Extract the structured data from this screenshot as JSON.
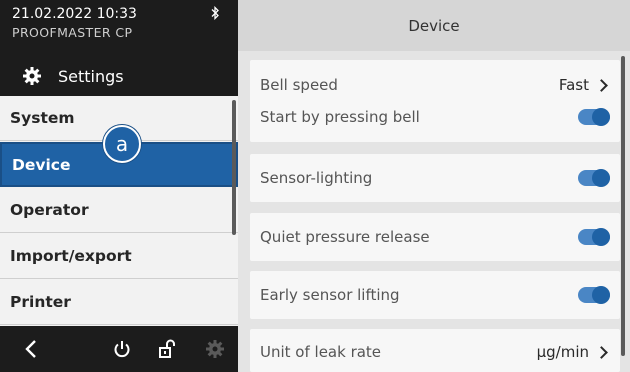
{
  "status": {
    "datetime": "21.02.2022 10:33",
    "device_name": "PROOFMASTER CP",
    "bluetooth_icon": "bluetooth-icon"
  },
  "sidebar": {
    "header_label": "Settings",
    "header_icon": "gear-icon",
    "items": [
      {
        "label": "System",
        "active": false
      },
      {
        "label": "Device",
        "active": true
      },
      {
        "label": "Operator",
        "active": false
      },
      {
        "label": "Import/export",
        "active": false
      },
      {
        "label": "Printer",
        "active": false
      }
    ],
    "badge": "a"
  },
  "bottombar": {
    "icons": [
      "back-icon",
      "power-icon",
      "unlock-icon",
      "gear-icon"
    ]
  },
  "main": {
    "title": "Device",
    "bell_speed": {
      "label": "Bell speed",
      "value": "Fast"
    },
    "start_by_pressing_bell": {
      "label": "Start by pressing bell",
      "enabled": true
    },
    "sensor_lighting": {
      "label": "Sensor-lighting",
      "enabled": true
    },
    "quiet_pressure_release": {
      "label": "Quiet pressure release",
      "enabled": true
    },
    "early_sensor_lifting": {
      "label": "Early sensor lifting",
      "enabled": true
    },
    "unit_of_leak_rate": {
      "label": "Unit of leak rate",
      "value": "µg/min"
    }
  },
  "colors": {
    "accent": "#1f62a5",
    "toggle_track": "#4a86c5",
    "dark_bg": "#1c1c1c",
    "panel_bg": "#e4e4e4"
  }
}
